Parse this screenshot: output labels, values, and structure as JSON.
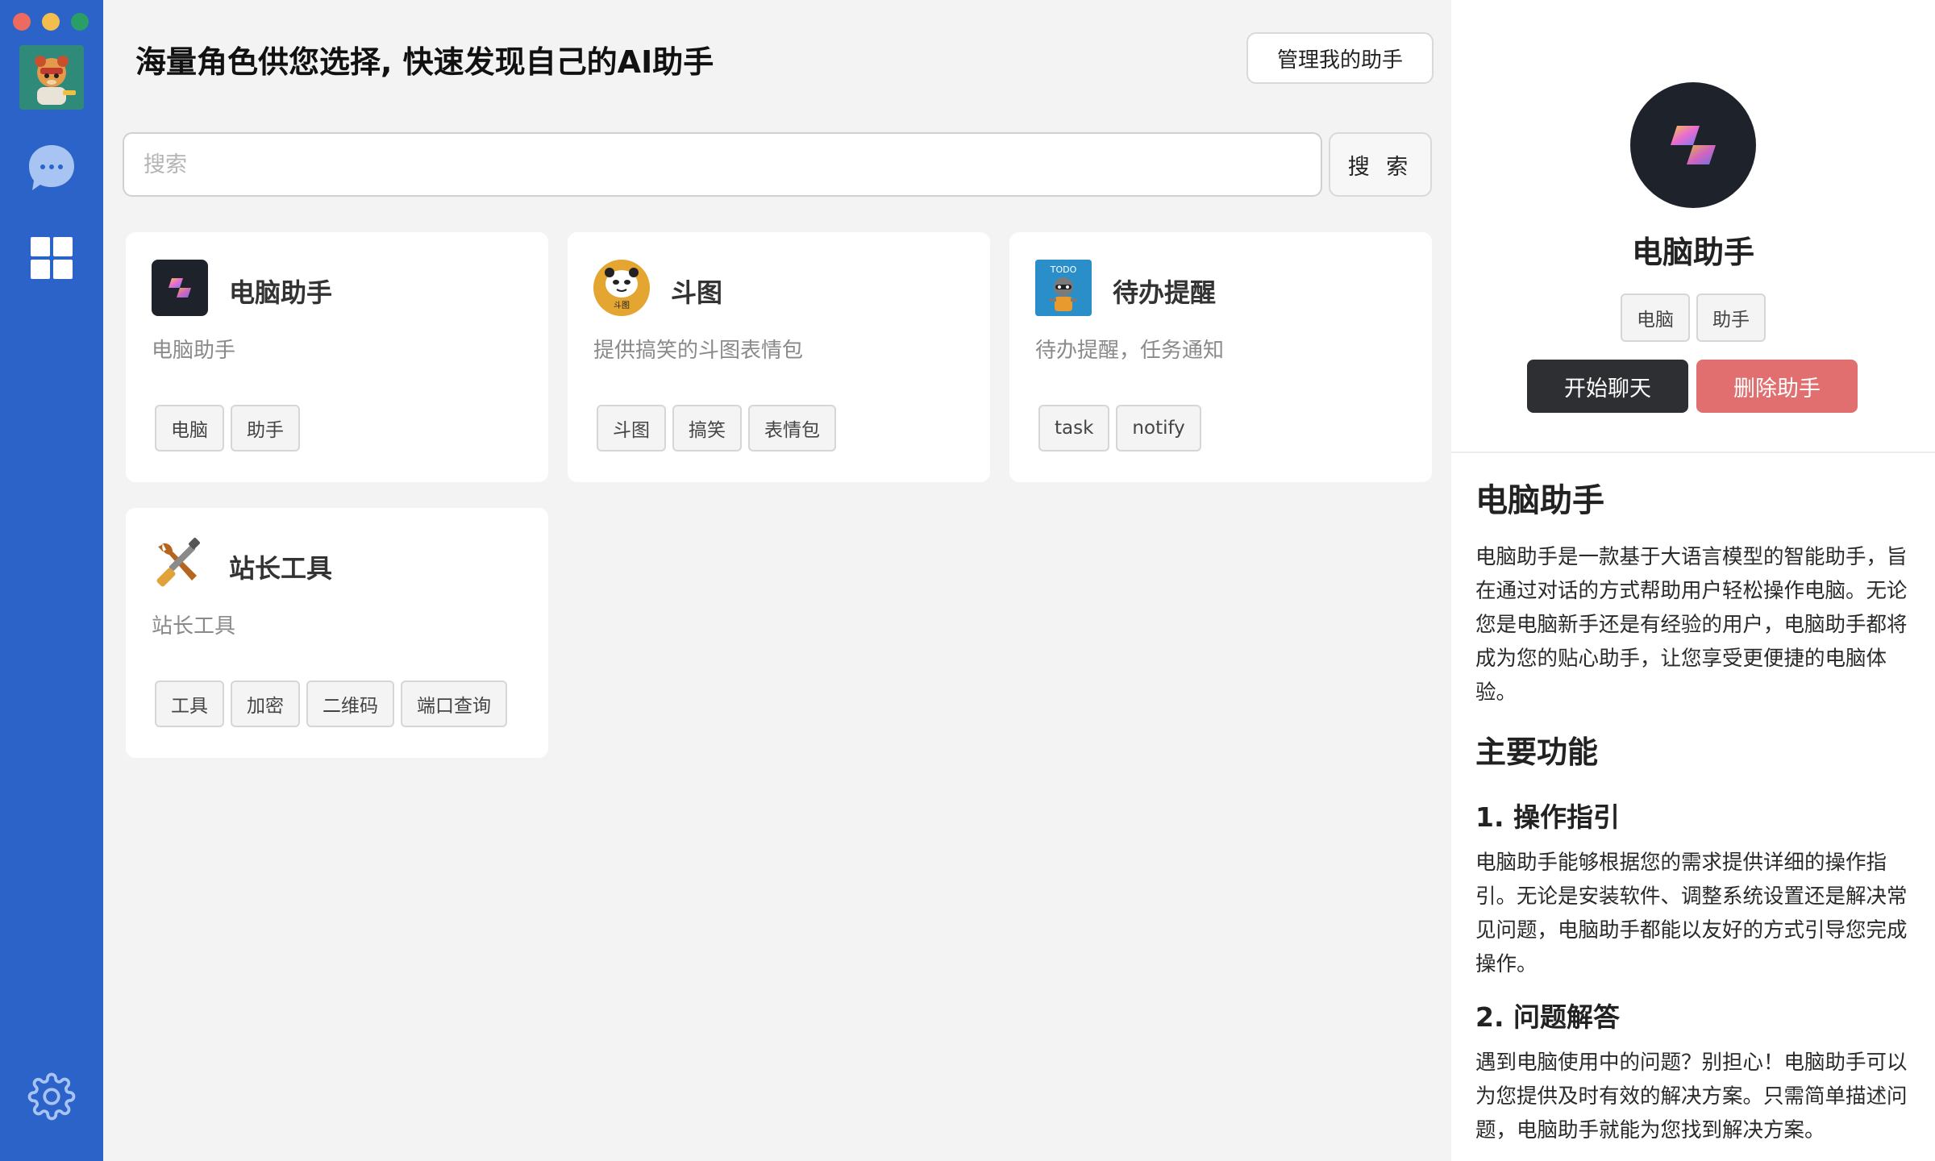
{
  "window": {
    "traffic_lights": [
      "close",
      "minimize",
      "maximize"
    ]
  },
  "sidebar": {
    "avatar_icon": "cartoon-avatar-icon",
    "items": [
      {
        "icon": "chat-bubble-icon"
      },
      {
        "icon": "grid-icon"
      },
      {
        "icon": "gear-icon"
      }
    ],
    "accent_color": "#2c63c9"
  },
  "header": {
    "title": "海量角色供您选择, 快速发现自己的AI助手",
    "manage_label": "管理我的助手"
  },
  "search": {
    "placeholder": "搜索",
    "value": "",
    "button_label": "搜 索"
  },
  "cards": [
    {
      "title": "电脑助手",
      "desc": "电脑助手",
      "tags": [
        "电脑",
        "助手"
      ],
      "icon": "copilot-logo-icon"
    },
    {
      "title": "斗图",
      "desc": "提供搞笑的斗图表情包",
      "tags": [
        "斗图",
        "搞笑",
        "表情包"
      ],
      "icon": "panda-meme-icon",
      "icon_text": "斗图"
    },
    {
      "title": "待办提醒",
      "desc": "待办提醒，任务通知",
      "tags": [
        "task",
        "notify"
      ],
      "icon": "todo-raccoon-icon",
      "icon_text": "TODO"
    },
    {
      "title": "站长工具",
      "desc": "站长工具",
      "tags": [
        "工具",
        "加密",
        "二维码",
        "端口查询"
      ],
      "icon": "wrench-screwdriver-icon"
    }
  ],
  "detail": {
    "name": "电脑助手",
    "tags": [
      "电脑",
      "助手"
    ],
    "start_label": "开始聊天",
    "delete_label": "删除助手",
    "delete_color": "#e26f6f",
    "doc": {
      "h1": "电脑助手",
      "intro": "电脑助手是一款基于大语言模型的智能助手，旨在通过对话的方式帮助用户轻松操作电脑。无论您是电脑新手还是有经验的用户，电脑助手都将成为您的贴心助手，让您享受更便捷的电脑体验。",
      "h2": "主要功能",
      "s1_title": "1. 操作指引",
      "s1_text": "电脑助手能够根据您的需求提供详细的操作指引。无论是安装软件、调整系统设置还是解决常见问题，电脑助手都能以友好的方式引导您完成操作。",
      "s2_title": "2. 问题解答",
      "s2_text": "遇到电脑使用中的问题？别担心！电脑助手可以为您提供及时有效的解决方案。只需简单描述问题，电脑助手就能为您找到解决方案。"
    }
  }
}
